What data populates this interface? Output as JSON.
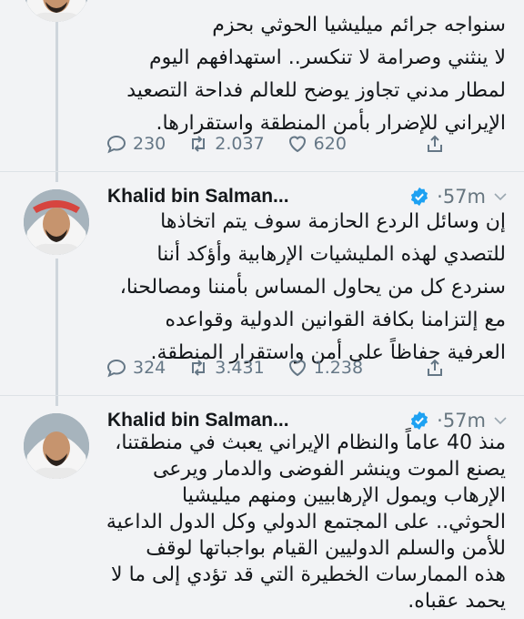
{
  "tweets": [
    {
      "lines": [
        "سنواجه جرائم ميليشيا الحوثي بحزم",
        "لا ينثني وصرامة لا تنكسر.. استهدافهم اليوم",
        "لمطار مدني تجاوز يوضح للعالم فداحة التصعيد",
        "الإيراني للإضرار بأمن المنطقة واستقرارها."
      ],
      "replies": "230",
      "retweets": "2.037",
      "likes": "620"
    },
    {
      "author": "Khalid bin Salman...",
      "time": "57m",
      "lines": [
        "إن وسائل الردع الحازمة سوف يتم اتخاذها",
        "للتصدي لهذه المليشيات الإرهابية وأؤكد أننا",
        "سنردع كل من يحاول المساس بأمننا ومصالحنا،",
        "مع إلتزامنا بكافة القوانين الدولية وقواعده",
        "العرفية حفاظاً على أمن واستقرار المنطقة."
      ],
      "replies": "324",
      "retweets": "3.431",
      "likes": "1.238"
    },
    {
      "author": "Khalid bin Salman...",
      "time": "57m",
      "lines": [
        "منذ 40 عاماً والنظام الإيراني يعبث في منطقتنا،",
        "يصنع الموت وينشر الفوضى والدمار ويرعى",
        "الإرهاب ويمول الإرهابيين ومنهم ميليشيا",
        "الحوثي.. على المجتمع الدولي وكل الدول الداعية",
        "للأمن والسلم الدوليين القيام بواجباتها لوقف",
        "هذه الممارسات الخطيرة التي قد تؤدي إلى ما لا",
        "يحمد عقباه."
      ]
    }
  ],
  "colors": {
    "verified": "#1da1f2",
    "action": "#657786",
    "name": "#14171a",
    "meta": "#66757f"
  }
}
